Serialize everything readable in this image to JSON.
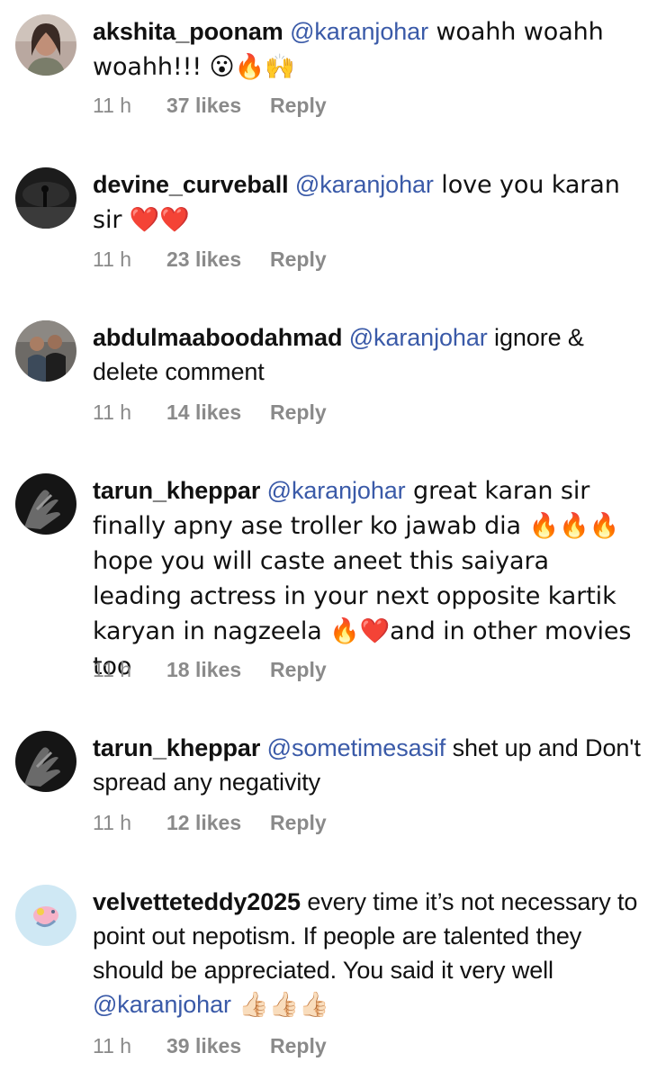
{
  "comments": [
    {
      "username": "akshita_poonam",
      "mention": "@karanjohar",
      "body": " woahh woahh woahh!!! 😮🔥🙌",
      "time": "11 h",
      "likes": "37 likes",
      "reply": "Reply"
    },
    {
      "username": "devine_curveball",
      "mention": "@karanjohar",
      "body": " love you karan sir ❤️❤️",
      "time": "11 h",
      "likes": "23 likes",
      "reply": "Reply"
    },
    {
      "username": "abdulmaaboodahmad",
      "mention": "@karanjohar",
      "body": " ignore & delete comment",
      "time": "11 h",
      "likes": "14 likes",
      "reply": "Reply"
    },
    {
      "username": "tarun_kheppar",
      "mention": "@karanjohar",
      "body": " great karan sir finally apny ase troller ko jawab dia 🔥🔥🔥 hope you will caste aneet this saiyara leading actress in your next opposite kartik karyan in nagzeela 🔥❤️and in other movies too",
      "time": "11 h",
      "likes": "18 likes",
      "reply": "Reply"
    },
    {
      "username": "tarun_kheppar",
      "mention": "@sometimesasif",
      "body": " shet up and Don't spread any negativity",
      "time": "11 h",
      "likes": "12 likes",
      "reply": "Reply"
    },
    {
      "username": "velvetteteddy2025",
      "body_pre": " every time it’s not necessary to point out nepotism. If people are talented they should be appreciated. You said it very well ",
      "mention": "@karanjohar",
      "body_post": " 👍🏻👍🏻👍🏻",
      "time": "11 h",
      "likes": "39 likes",
      "reply": "Reply"
    }
  ]
}
